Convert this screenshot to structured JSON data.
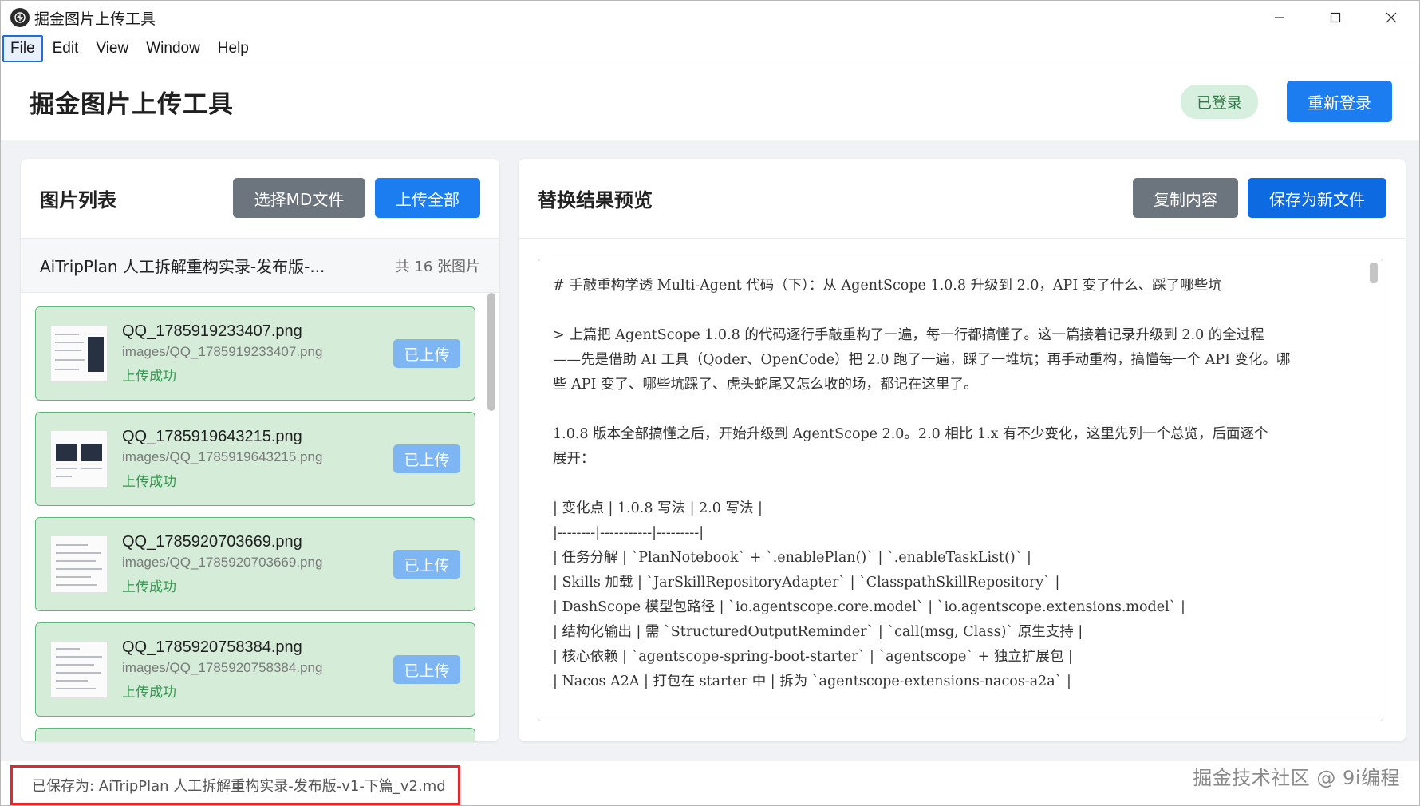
{
  "window": {
    "title": "掘金图片上传工具",
    "icon": "app-logo-icon"
  },
  "menu": [
    "File",
    "Edit",
    "View",
    "Window",
    "Help"
  ],
  "header": {
    "title": "掘金图片上传工具",
    "status": "已登录",
    "relogin_label": "重新登录"
  },
  "left_panel": {
    "title": "图片列表",
    "select_md_label": "选择MD文件",
    "upload_all_label": "上传全部",
    "file_name": "AiTripPlan 人工拆解重构实录-发布版-...",
    "file_count": "共 16 张图片",
    "items": [
      {
        "name": "QQ_1785919233407.png",
        "path": "images/QQ_1785919233407.png",
        "status": "上传成功",
        "button": "已上传"
      },
      {
        "name": "QQ_1785919643215.png",
        "path": "images/QQ_1785919643215.png",
        "status": "上传成功",
        "button": "已上传"
      },
      {
        "name": "QQ_1785920703669.png",
        "path": "images/QQ_1785920703669.png",
        "status": "上传成功",
        "button": "已上传"
      },
      {
        "name": "QQ_1785920758384.png",
        "path": "images/QQ_1785920758384.png",
        "status": "上传成功",
        "button": "已上传"
      }
    ]
  },
  "right_panel": {
    "title": "替换结果预览",
    "copy_label": "复制内容",
    "save_label": "保存为新文件",
    "content": {
      "heading": "# 手敲重构学透 Multi-Agent 代码（下）：从 AgentScope 1.0.8 升级到 2.0，API 变了什么、踩了哪些坑",
      "quote": [
        "> 上篇把 AgentScope 1.0.8 的代码逐行手敲重构了一遍，每一行都搞懂了。这一篇接着记录升级到 2.0 的全过程",
        "——先是借助 AI 工具（Qoder、OpenCode）把 2.0 跑了一遍，踩了一堆坑；再手动重构，搞懂每一个 API 变化。哪",
        "些 API 变了、哪些坑踩了、虎头蛇尾又怎么收的场，都记在这里了。"
      ],
      "intro": [
        "1.0.8 版本全部搞懂之后，开始升级到 AgentScope 2.0。2.0 相比 1.x 有不少变化，这里先列一个总览，后面逐个",
        "展开："
      ],
      "table": [
        "| 变化点 | 1.0.8 写法 | 2.0 写法 |",
        "|--------|-----------|---------|",
        "| 任务分解 | `PlanNotebook` + `.enablePlan()` | `.enableTaskList()` |",
        "| Skills 加载 | `JarSkillRepositoryAdapter` | `ClasspathSkillRepository` |",
        "| DashScope 模型包路径 | `io.agentscope.core.model` | `io.agentscope.extensions.model` |",
        "| 结构化输出 | 需 `StructuredOutputReminder` | `call(msg, Class)` 原生支持 |",
        "| 核心依赖 | `agentscope-spring-boot-starter` | `agentscope` + 独立扩展包 |",
        "| Nacos A2A | 打包在 starter 中 | 拆为 `agentscope-extensions-nacos-a2a` |"
      ]
    }
  },
  "status_bar": {
    "saved_message": "已保存为: AiTripPlan 人工拆解重构实录-发布版-v1-下篇_v2.md",
    "watermark": "掘金技术社区 @ 9i编程"
  },
  "colors": {
    "primary": "#1b7df0",
    "success_bg": "#d5ecd9",
    "success_border": "#5cb87a",
    "success_text": "#2f9a4c",
    "highlight_border": "#e6262a"
  }
}
